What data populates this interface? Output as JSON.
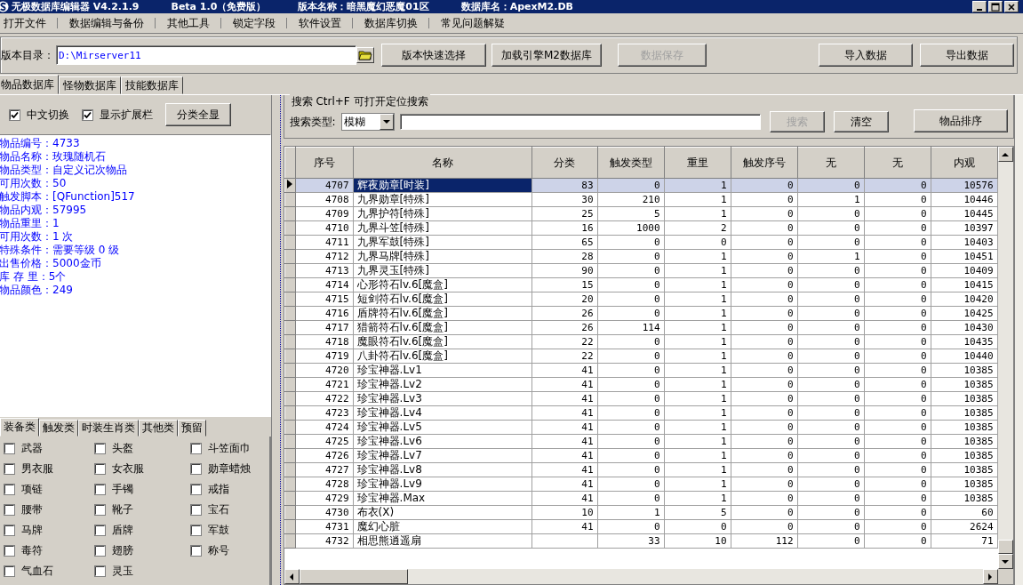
{
  "window": {
    "title_parts": [
      "无极数据库编辑器 V4.2.1.9",
      "Beta 1.0（免费版）",
      "版本名称：暗黑魔幻恶魔01区",
      "数据库名：ApexM2.DB"
    ]
  },
  "menu": [
    "打开文件",
    "数据编辑与备份",
    "其他工具",
    "锁定字段",
    "软件设置",
    "数据库切换",
    "常见问题解疑"
  ],
  "toolbar": {
    "path_label": "版本目录：",
    "path_value": "D:\\Mirserver11",
    "buttons": [
      {
        "label": "版本快速选择",
        "disabled": false
      },
      {
        "label": "加载引擎M2数据库",
        "disabled": false
      },
      {
        "label": "数据保存",
        "disabled": true
      },
      {
        "label": "导入数据",
        "disabled": false
      },
      {
        "label": "导出数据",
        "disabled": false
      }
    ]
  },
  "db_tabs": [
    {
      "label": "物品数据库",
      "selected": true
    },
    {
      "label": "怪物数据库",
      "selected": false
    },
    {
      "label": "技能数据库",
      "selected": false
    }
  ],
  "options": {
    "checkboxes": [
      {
        "label": "中文切换",
        "checked": true
      },
      {
        "label": "显示扩展栏",
        "checked": true
      }
    ],
    "button": "分类全显"
  },
  "item_info": [
    "物品编号：4733",
    "物品名称：玫瑰随机石",
    "物品类型：自定义记次物品",
    "可用次数：50",
    "触发脚本：[QFunction]517",
    "物品内观：57995",
    "物品重里：1",
    "可用次数：1 次",
    "特殊条件：需要等级 0 级",
    "出售价格：5000金币",
    "库 存 里：5个",
    "物品颜色：249"
  ],
  "category_tabs": [
    {
      "label": "装备类",
      "selected": true
    },
    {
      "label": "触发类",
      "selected": false
    },
    {
      "label": "时装生肖类",
      "selected": false
    },
    {
      "label": "其他类",
      "selected": false
    },
    {
      "label": "预留",
      "selected": false
    }
  ],
  "categories": [
    {
      "label": "武器",
      "checked": false
    },
    {
      "label": "头盔",
      "checked": false
    },
    {
      "label": "斗笠面巾",
      "checked": false
    },
    {
      "label": "男衣服",
      "checked": false
    },
    {
      "label": "女衣服",
      "checked": false
    },
    {
      "label": "勋章蜡烛",
      "checked": false
    },
    {
      "label": "项链",
      "checked": false
    },
    {
      "label": "手镯",
      "checked": false
    },
    {
      "label": "戒指",
      "checked": false
    },
    {
      "label": "腰带",
      "checked": false
    },
    {
      "label": "靴子",
      "checked": false
    },
    {
      "label": "宝石",
      "checked": false
    },
    {
      "label": "马牌",
      "checked": false
    },
    {
      "label": "盾牌",
      "checked": false
    },
    {
      "label": "军鼓",
      "checked": false
    },
    {
      "label": "毒符",
      "checked": false
    },
    {
      "label": "翅膀",
      "checked": false
    },
    {
      "label": "称号",
      "checked": false
    },
    {
      "label": "气血石",
      "checked": false
    },
    {
      "label": "灵玉",
      "checked": false
    }
  ],
  "search": {
    "title": "搜索  Ctrl+F 可打开定位搜索",
    "type_label": "搜索类型:",
    "type_value": "模糊",
    "buttons": [
      {
        "label": "搜索",
        "disabled": true
      },
      {
        "label": "清空",
        "disabled": false
      }
    ],
    "sort_button": "物品排序"
  },
  "table": {
    "columns": [
      "序号",
      "名称",
      "分类",
      "触发类型",
      "重里",
      "触发序号",
      "无",
      "无",
      "内观"
    ],
    "rows": [
      {
        "selected": true,
        "cells": [
          "4707",
          "辉夜勋章[时装]",
          "83",
          "0",
          "1",
          "0",
          "0",
          "0",
          "10576"
        ]
      },
      {
        "selected": false,
        "cells": [
          "4708",
          "九界勋章[特殊]",
          "30",
          "210",
          "1",
          "0",
          "1",
          "0",
          "10446"
        ]
      },
      {
        "selected": false,
        "cells": [
          "4709",
          "九界护符[特殊]",
          "25",
          "5",
          "1",
          "0",
          "0",
          "0",
          "10445"
        ]
      },
      {
        "selected": false,
        "cells": [
          "4710",
          "九界斗笠[特殊]",
          "16",
          "1000",
          "2",
          "0",
          "0",
          "0",
          "10397"
        ]
      },
      {
        "selected": false,
        "cells": [
          "4711",
          "九界军鼓[特殊]",
          "65",
          "0",
          "0",
          "0",
          "0",
          "0",
          "10403"
        ]
      },
      {
        "selected": false,
        "cells": [
          "4712",
          "九界马牌[特殊]",
          "28",
          "0",
          "1",
          "0",
          "1",
          "0",
          "10451"
        ]
      },
      {
        "selected": false,
        "cells": [
          "4713",
          "九界灵玉[特殊]",
          "90",
          "0",
          "1",
          "0",
          "0",
          "0",
          "10409"
        ]
      },
      {
        "selected": false,
        "cells": [
          "4714",
          "心形符石lv.6[魔盒]",
          "15",
          "0",
          "1",
          "0",
          "0",
          "0",
          "10415"
        ]
      },
      {
        "selected": false,
        "cells": [
          "4715",
          "短剑符石lv.6[魔盒]",
          "20",
          "0",
          "1",
          "0",
          "0",
          "0",
          "10420"
        ]
      },
      {
        "selected": false,
        "cells": [
          "4716",
          "盾牌符石lv.6[魔盒]",
          "26",
          "0",
          "1",
          "0",
          "0",
          "0",
          "10425"
        ]
      },
      {
        "selected": false,
        "cells": [
          "4717",
          "猎箭符石lv.6[魔盒]",
          "26",
          "114",
          "1",
          "0",
          "0",
          "0",
          "10430"
        ]
      },
      {
        "selected": false,
        "cells": [
          "4718",
          "魔眼符石lv.6[魔盒]",
          "22",
          "0",
          "1",
          "0",
          "0",
          "0",
          "10435"
        ]
      },
      {
        "selected": false,
        "cells": [
          "4719",
          "八卦符石lv.6[魔盒]",
          "22",
          "0",
          "1",
          "0",
          "0",
          "0",
          "10440"
        ]
      },
      {
        "selected": false,
        "cells": [
          "4720",
          "珍宝神器.Lv1",
          "41",
          "0",
          "1",
          "0",
          "0",
          "0",
          "10385"
        ]
      },
      {
        "selected": false,
        "cells": [
          "4721",
          "珍宝神器.Lv2",
          "41",
          "0",
          "1",
          "0",
          "0",
          "0",
          "10385"
        ]
      },
      {
        "selected": false,
        "cells": [
          "4722",
          "珍宝神器.Lv3",
          "41",
          "0",
          "1",
          "0",
          "0",
          "0",
          "10385"
        ]
      },
      {
        "selected": false,
        "cells": [
          "4723",
          "珍宝神器.Lv4",
          "41",
          "0",
          "1",
          "0",
          "0",
          "0",
          "10385"
        ]
      },
      {
        "selected": false,
        "cells": [
          "4724",
          "珍宝神器.Lv5",
          "41",
          "0",
          "1",
          "0",
          "0",
          "0",
          "10385"
        ]
      },
      {
        "selected": false,
        "cells": [
          "4725",
          "珍宝神器.Lv6",
          "41",
          "0",
          "1",
          "0",
          "0",
          "0",
          "10385"
        ]
      },
      {
        "selected": false,
        "cells": [
          "4726",
          "珍宝神器.Lv7",
          "41",
          "0",
          "1",
          "0",
          "0",
          "0",
          "10385"
        ]
      },
      {
        "selected": false,
        "cells": [
          "4727",
          "珍宝神器.Lv8",
          "41",
          "0",
          "1",
          "0",
          "0",
          "0",
          "10385"
        ]
      },
      {
        "selected": false,
        "cells": [
          "4728",
          "珍宝神器.Lv9",
          "41",
          "0",
          "1",
          "0",
          "0",
          "0",
          "10385"
        ]
      },
      {
        "selected": false,
        "cells": [
          "4729",
          "珍宝神器.Max",
          "41",
          "0",
          "1",
          "0",
          "0",
          "0",
          "10385"
        ]
      },
      {
        "selected": false,
        "cells": [
          "4730",
          "布衣(X)",
          "10",
          "1",
          "5",
          "0",
          "0",
          "0",
          "60"
        ]
      },
      {
        "selected": false,
        "cells": [
          "4731",
          "魔幻心脏",
          "41",
          "0",
          "0",
          "0",
          "0",
          "0",
          "2624"
        ]
      },
      {
        "selected": false,
        "cells": [
          "4732",
          "相思熊逍遥扇",
          null,
          "33",
          "10",
          "112",
          "0",
          "0",
          "71"
        ]
      }
    ]
  }
}
